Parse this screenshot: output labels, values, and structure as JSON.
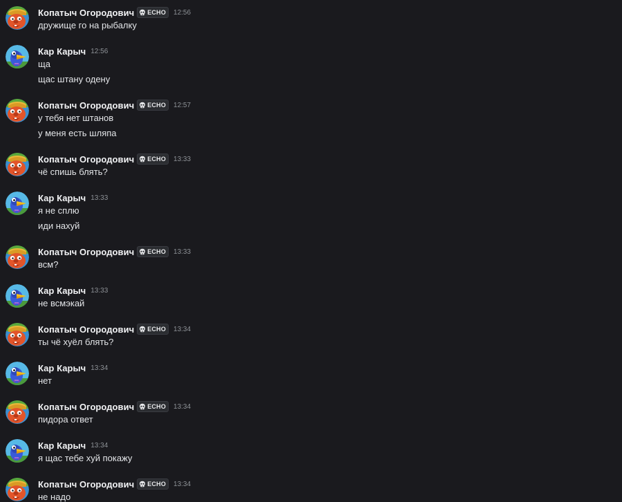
{
  "channel": {
    "badge_label": "ECHO",
    "badge_icon": "skull-icon",
    "messages": [
      {
        "author": "Копатыч Огородович",
        "avatar": "kopatych",
        "badge": true,
        "time": "12:56",
        "lines": [
          "дружище го на рыбалку"
        ]
      },
      {
        "author": "Кар Карыч",
        "avatar": "karych",
        "badge": false,
        "time": "12:56",
        "lines": [
          "ща",
          "щас штану одену"
        ]
      },
      {
        "author": "Копатыч Огородович",
        "avatar": "kopatych",
        "badge": true,
        "time": "12:57",
        "lines": [
          "у тебя нет штанов",
          "у меня есть шляпа"
        ]
      },
      {
        "author": "Копатыч Огородович",
        "avatar": "kopatych",
        "badge": true,
        "time": "13:33",
        "lines": [
          "чё спишь блять?"
        ]
      },
      {
        "author": "Кар Карыч",
        "avatar": "karych",
        "badge": false,
        "time": "13:33",
        "lines": [
          "я не сплю",
          "иди нахуй"
        ]
      },
      {
        "author": "Копатыч Огородович",
        "avatar": "kopatych",
        "badge": true,
        "time": "13:33",
        "lines": [
          "всм?"
        ]
      },
      {
        "author": "Кар Карыч",
        "avatar": "karych",
        "badge": false,
        "time": "13:33",
        "lines": [
          "не всмэкай"
        ]
      },
      {
        "author": "Копатыч Огородович",
        "avatar": "kopatych",
        "badge": true,
        "time": "13:34",
        "lines": [
          "ты чё хуёл блять?"
        ]
      },
      {
        "author": "Кар Карыч",
        "avatar": "karych",
        "badge": false,
        "time": "13:34",
        "lines": [
          "нет"
        ]
      },
      {
        "author": "Копатыч Огородович",
        "avatar": "kopatych",
        "badge": true,
        "time": "13:34",
        "lines": [
          "пидора ответ"
        ]
      },
      {
        "author": "Кар Карыч",
        "avatar": "karych",
        "badge": false,
        "time": "13:34",
        "lines": [
          "я щас тебе хуй покажу"
        ]
      },
      {
        "author": "Копатыч Огородович",
        "avatar": "kopatych",
        "badge": true,
        "time": "13:34",
        "lines": [
          "не надо"
        ]
      }
    ]
  }
}
